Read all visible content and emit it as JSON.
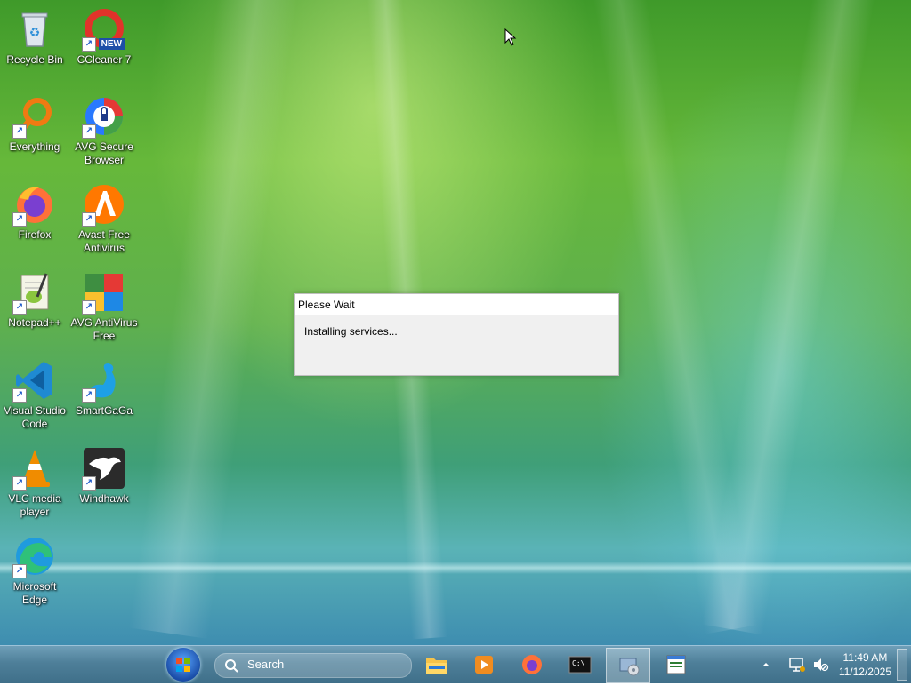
{
  "desktop": {
    "icons": [
      {
        "label": "Recycle Bin"
      },
      {
        "label": "CCleaner 7",
        "badge": "NEW"
      },
      {
        "label": "Everything"
      },
      {
        "label": "AVG Secure Browser"
      },
      {
        "label": "Firefox"
      },
      {
        "label": "Avast Free Antivirus"
      },
      {
        "label": "Notepad++"
      },
      {
        "label": "AVG AntiVirus Free"
      },
      {
        "label": "Visual Studio Code"
      },
      {
        "label": "SmartGaGa"
      },
      {
        "label": "VLC media player"
      },
      {
        "label": "Windhawk"
      },
      {
        "label": "Microsoft Edge"
      }
    ]
  },
  "dialog": {
    "title": "Please Wait",
    "message": "Installing services..."
  },
  "taskbar": {
    "search_placeholder": "Search",
    "clock": {
      "time": "11:49 AM",
      "date": "11/12/2025"
    },
    "apps": [
      "file-explorer",
      "media-player",
      "firefox",
      "command-prompt",
      "installer",
      "notepad"
    ]
  },
  "colors": {
    "taskbar": "#4e7f99",
    "dialog_bg": "#f0f0f0"
  }
}
